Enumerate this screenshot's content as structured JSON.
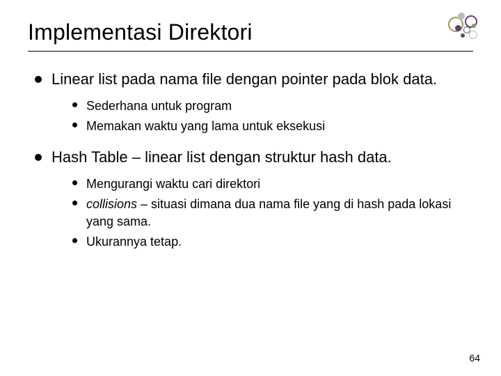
{
  "title": "Implementasi Direktori",
  "bullets": {
    "b1": {
      "text": "Linear list pada nama file dengan pointer pada blok data.",
      "sub": [
        "Sederhana untuk program",
        "Memakan waktu yang lama untuk eksekusi"
      ]
    },
    "b2": {
      "text": "Hash Table – linear list dengan struktur hash data.",
      "sub": {
        "s1": "Mengurangi waktu cari direktori",
        "s2_italic": "collisions",
        "s2_rest": " – situasi dimana dua nama file yang di hash pada lokasi yang sama.",
        "s3": "Ukurannya tetap."
      }
    }
  },
  "page_number": "64",
  "ornament_colors": {
    "olive": "#9a9a4a",
    "plum": "#6a3b7a",
    "gray": "#bcbcbc",
    "dark": "#555555"
  }
}
